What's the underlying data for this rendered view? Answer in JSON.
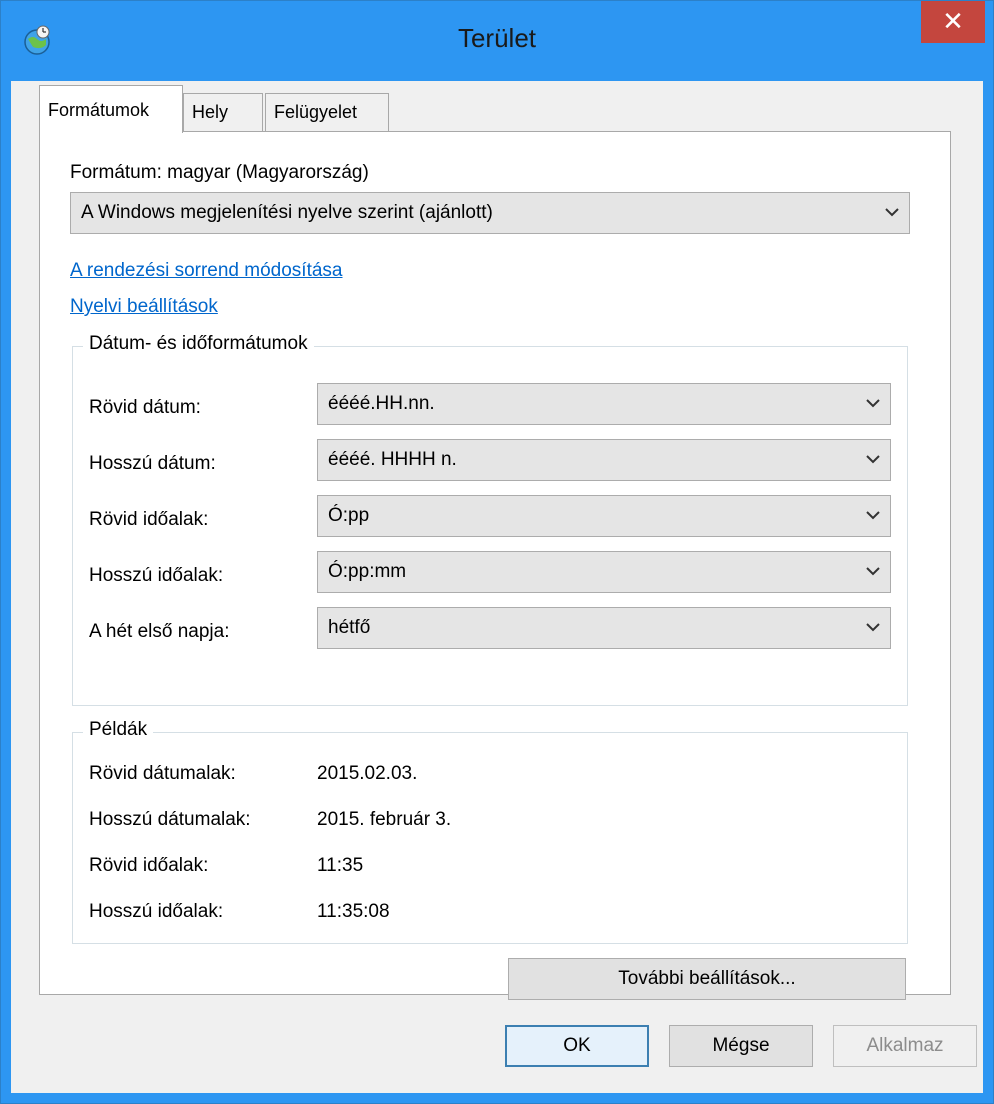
{
  "window": {
    "title": "Terület",
    "close_glyph": "✕"
  },
  "tabs": [
    {
      "label": "Formátumok",
      "active": true
    },
    {
      "label": "Hely",
      "active": false
    },
    {
      "label": "Felügyelet",
      "active": false
    }
  ],
  "format": {
    "label": "Formátum: magyar (Magyarország)",
    "selected": "A Windows megjelenítési nyelve szerint (ajánlott)"
  },
  "links": {
    "sort_order": "A rendezési sorrend módosítása",
    "language_settings": "Nyelvi beállítások"
  },
  "date_time": {
    "title": "Dátum- és időformátumok",
    "rows": [
      {
        "label": "Rövid dátum:",
        "value": "éééé.HH.nn."
      },
      {
        "label": "Hosszú dátum:",
        "value": "éééé. HHHH n."
      },
      {
        "label": "Rövid időalak:",
        "value": "Ó:pp"
      },
      {
        "label": "Hosszú időalak:",
        "value": "Ó:pp:mm"
      },
      {
        "label": "A hét első napja:",
        "value": "hétfő"
      }
    ]
  },
  "examples": {
    "title": "Példák",
    "rows": [
      {
        "label": "Rövid dátumalak:",
        "value": "2015.02.03."
      },
      {
        "label": "Hosszú dátumalak:",
        "value": "2015. február 3."
      },
      {
        "label": "Rövid időalak:",
        "value": "11:35"
      },
      {
        "label": "Hosszú időalak:",
        "value": "11:35:08"
      }
    ]
  },
  "buttons": {
    "more_settings": "További beállítások...",
    "ok": "OK",
    "cancel": "Mégse",
    "apply": "Alkalmaz"
  },
  "icons": {
    "app": "region-globe-icon",
    "dropdown": "chevron-down-icon",
    "close": "close-icon"
  },
  "colors": {
    "titlebar": "#2d96f2",
    "close": "#c4463e",
    "link": "#0066cc"
  }
}
